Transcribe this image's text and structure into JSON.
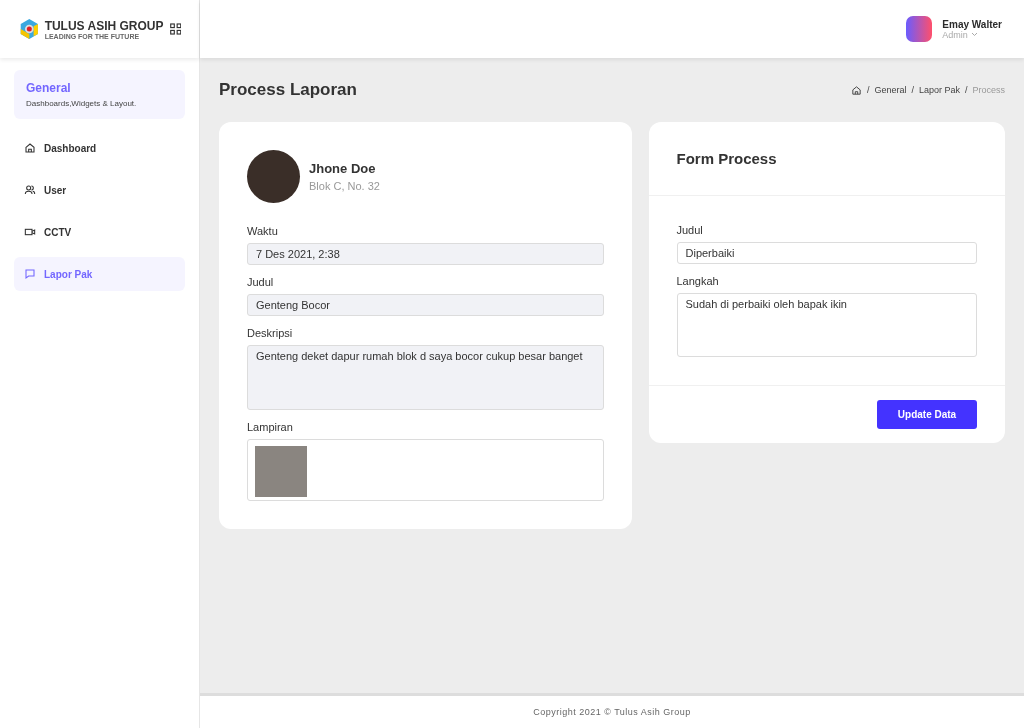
{
  "logo": {
    "name": "TULUS ASIH GROUP",
    "tagline": "LEADING FOR THE FUTURE"
  },
  "sidebar": {
    "group": {
      "title": "General",
      "subtitle": "Dashboards,Widgets & Layout."
    },
    "items": [
      {
        "label": "Dashboard",
        "selected": false
      },
      {
        "label": "User",
        "selected": false
      },
      {
        "label": "CCTV",
        "selected": false
      },
      {
        "label": "Lapor Pak",
        "selected": true
      }
    ]
  },
  "user": {
    "name": "Emay Walter",
    "role": "Admin"
  },
  "page": {
    "title": "Process Laporan",
    "breadcrumb": [
      {
        "separator": "/",
        "label": "General"
      },
      {
        "separator": "/",
        "label": "Lapor Pak"
      },
      {
        "separator": "/",
        "label": "Process"
      }
    ]
  },
  "report": {
    "name": "Jhone Doe",
    "address": "Blok C, No. 32",
    "fields": [
      {
        "label": "Waktu",
        "value": "7 Des 2021, 2:38",
        "kind": "input",
        "disabled": true
      },
      {
        "label": "Judul",
        "value": "Genteng Bocor",
        "kind": "input",
        "disabled": true
      },
      {
        "label": "Deskripsi",
        "value": "Genteng deket dapur rumah blok d saya bocor cukup besar banget",
        "kind": "textarea",
        "disabled": true
      }
    ],
    "attachment_label": "Lampiran"
  },
  "form": {
    "title": "Form Process",
    "fields": [
      {
        "label": "Judul",
        "value": "Diperbaiki",
        "kind": "input",
        "disabled": false
      },
      {
        "label": "Langkah",
        "value": "Sudah di perbaiki oleh bapak ikin",
        "kind": "textarea",
        "disabled": false
      }
    ],
    "button": "Update Data"
  },
  "footer": "Copyright 2021 © Tulus Asih Group"
}
